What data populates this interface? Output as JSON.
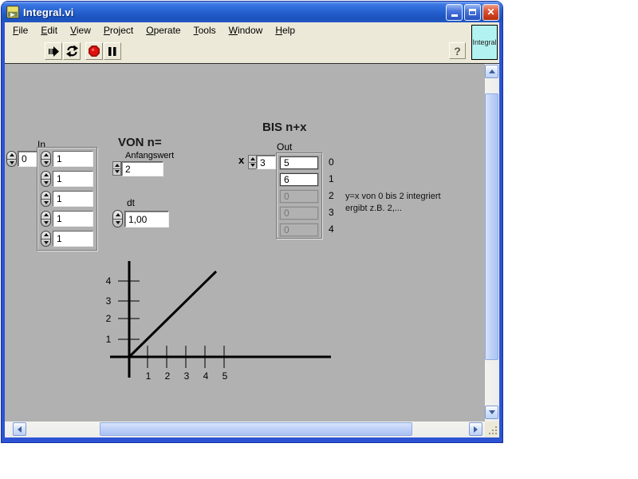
{
  "window": {
    "title": "Integral.vi",
    "icons": {
      "minimize": "minimize-bar",
      "maximize": "square-outline",
      "close": "✕"
    }
  },
  "menu": {
    "items": [
      {
        "mnemonic": "F",
        "rest": "ile"
      },
      {
        "mnemonic": "E",
        "rest": "dit"
      },
      {
        "mnemonic": "V",
        "rest": "iew"
      },
      {
        "mnemonic": "P",
        "rest": "roject"
      },
      {
        "mnemonic": "O",
        "rest": "perate"
      },
      {
        "mnemonic": "T",
        "rest": "ools"
      },
      {
        "mnemonic": "W",
        "rest": "indow"
      },
      {
        "mnemonic": "H",
        "rest": "elp"
      }
    ]
  },
  "toolbar": {
    "icons": [
      "run-arrow",
      "run-continuous",
      "abort-stop",
      "pause"
    ],
    "help_label": "?",
    "vi_icon_label": "Integral"
  },
  "panel": {
    "in_array": {
      "label": "In",
      "index_value": "0",
      "elements": [
        "1",
        "1",
        "1",
        "1",
        "1"
      ]
    },
    "von": {
      "heading": "VON n=",
      "label": "Anfangswert",
      "value": "2"
    },
    "dt": {
      "label": "dt",
      "value": "1,00"
    },
    "bis": {
      "heading": "BIS n+x",
      "x_label": "x",
      "x_value": "3",
      "out": {
        "label": "Out",
        "values": [
          "5",
          "6",
          "0",
          "0",
          "0"
        ],
        "dimmed": [
          false,
          false,
          true,
          true,
          true
        ],
        "indices": [
          "0",
          "1",
          "2",
          "3",
          "4"
        ]
      }
    },
    "note": {
      "line1": "y=x von 0 bis 2 integriert",
      "line2": "ergibt z.B. 2,..."
    }
  },
  "graph": {
    "type": "line",
    "description": "y=x sketch, diagonal line from origin",
    "x_ticks": [
      "1",
      "2",
      "3",
      "4",
      "5"
    ],
    "y_ticks": [
      "4",
      "3",
      "2",
      "1"
    ],
    "line_from": [
      0,
      0
    ],
    "line_to": [
      4.5,
      4.5
    ]
  },
  "colors": {
    "panel_bg": "#b1b1b1",
    "chrome_bg": "#ece9d8",
    "titlebar_blue": "#2763d2",
    "border_blue": "#2b53d4",
    "vi_icon_bg": "#b2f3f1",
    "abort_red": "#dd0000",
    "dimmed_text": "#777777"
  }
}
